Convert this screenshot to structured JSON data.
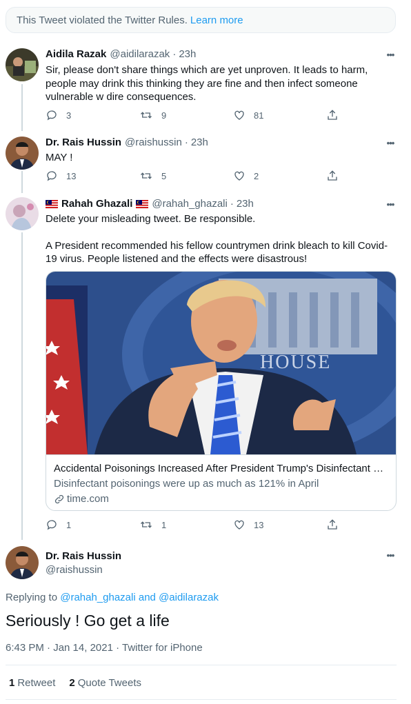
{
  "banner": {
    "text": "This Tweet violated the Twitter Rules.",
    "link": "Learn more"
  },
  "tweets": [
    {
      "name": "Aidila Razak",
      "handle": "@aidilarazak",
      "time": "23h",
      "lines": [
        "Sir, please don't share things which are yet unproven. It leads to harm,",
        "people may drink this thinking they are fine and then infect someone",
        "vulnerable w dire consequences."
      ],
      "replies": "3",
      "retweets": "9",
      "likes": "81"
    },
    {
      "name": "Dr. Rais Hussin",
      "handle": "@raishussin",
      "time": "23h",
      "lines": [
        "MAY !"
      ],
      "replies": "13",
      "retweets": "5",
      "likes": "2"
    },
    {
      "name": "Rahah Ghazali",
      "handle": "@rahah_ghazali",
      "time": "23h",
      "lines": [
        "Delete your misleading tweet. Be responsible.",
        "A President recommended his fellow countrymen drink bleach to kill Covid-",
        "19 virus. People listened and the effects were disastrous!"
      ],
      "replies": "1",
      "retweets": "1",
      "likes": "13",
      "card": {
        "image_text": "HOUSE",
        "title": "Accidental Poisonings Increased After President Trump's Disinfectant Co...",
        "description": "Disinfectant poisonings were up as much as 121% in April",
        "domain": "time.com"
      }
    }
  ],
  "main": {
    "name": "Dr. Rais Hussin",
    "handle": "@raishussin",
    "replying_prefix": "Replying to",
    "mention1": "@rahah_ghazali",
    "and": "and",
    "mention2": "@aidilarazak",
    "text": "Seriously ! Go get a life",
    "timestamp": "6:43 PM · Jan 14, 2021 · Twitter for iPhone",
    "retweets_count": "1",
    "retweets_label": "Retweet",
    "quotes_count": "2",
    "quotes_label": "Quote Tweets"
  },
  "colors": {
    "accent": "#1d9bf0",
    "muted": "#536471"
  }
}
